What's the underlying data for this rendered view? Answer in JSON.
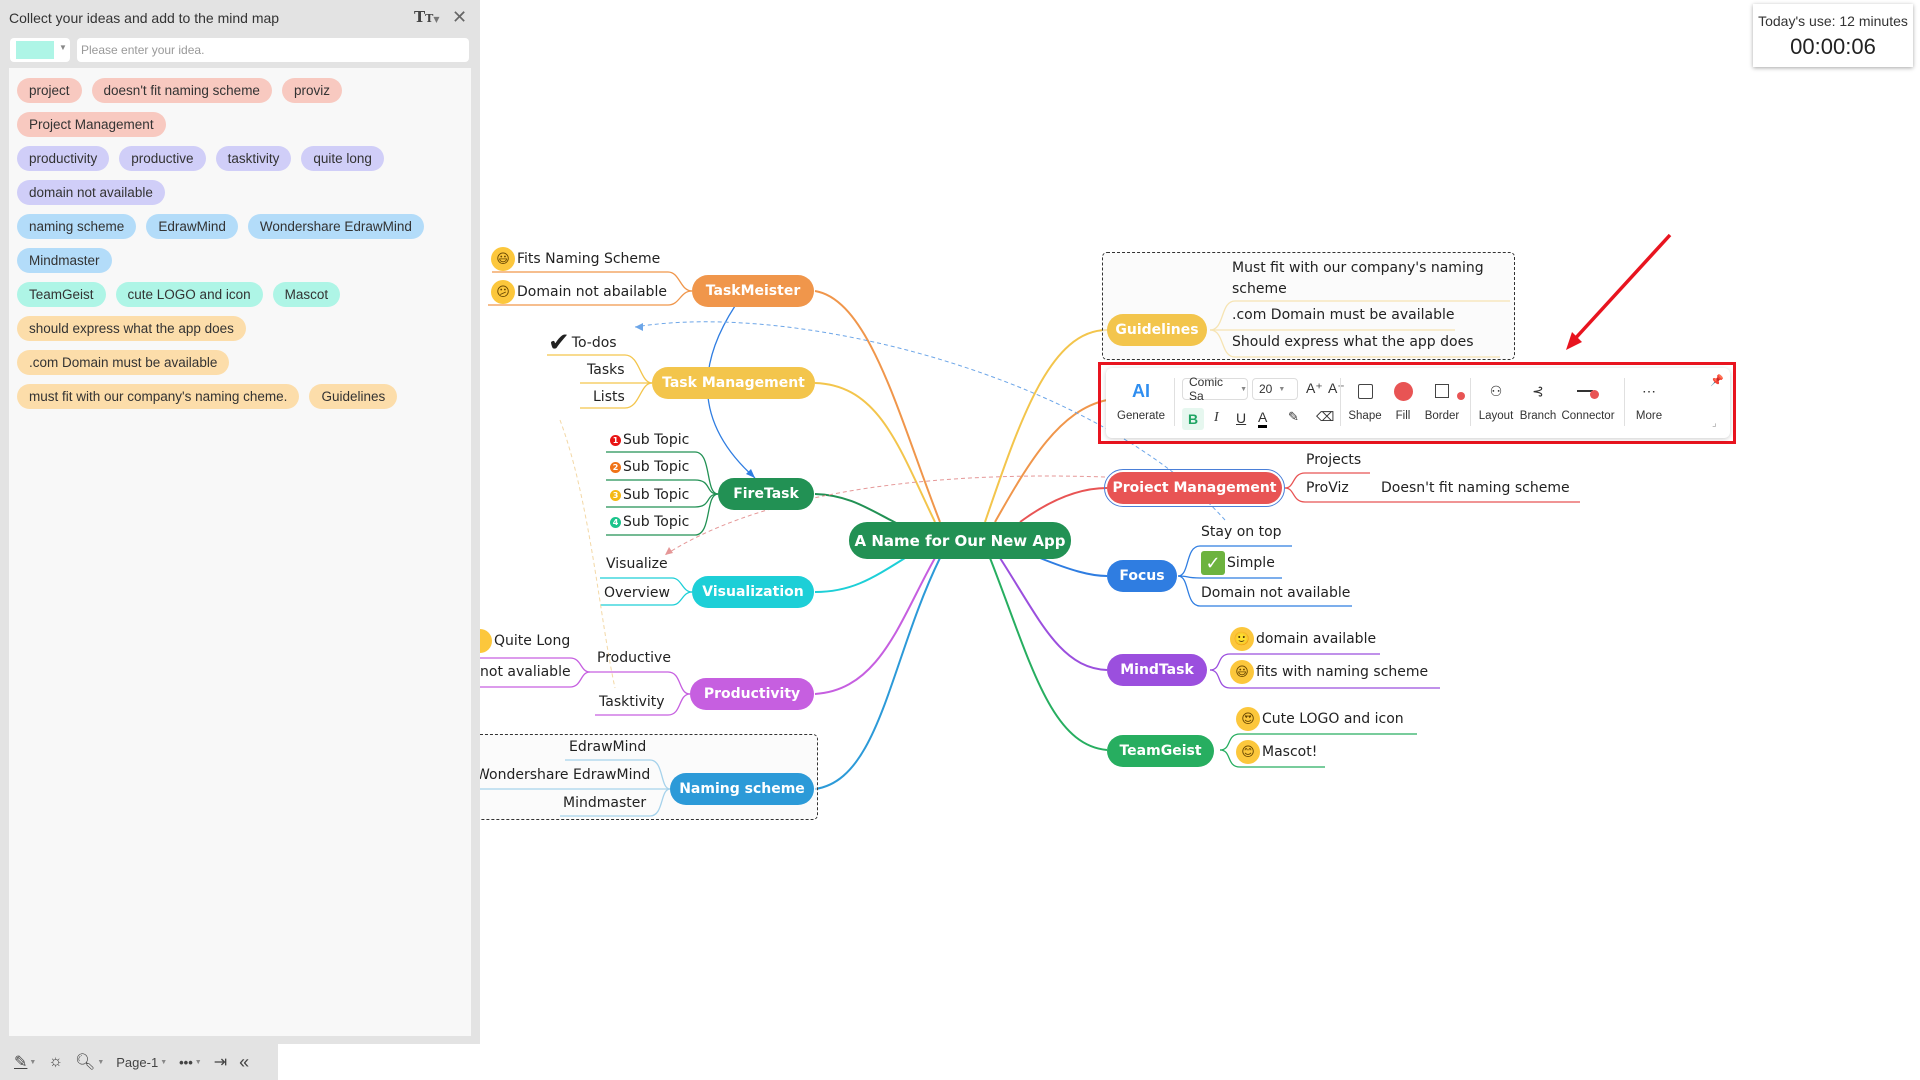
{
  "left_panel": {
    "title": "Collect your ideas and add to the mind map",
    "font_tool_icon": "text-size-icon",
    "close_icon": "close-icon",
    "color_swatch": "#aef5e6",
    "input_placeholder": "Please enter your idea.",
    "tag_rows": [
      [
        {
          "label": "project",
          "color": "#f8c9c0"
        },
        {
          "label": "doesn't fit naming scheme",
          "color": "#f8c9c0"
        },
        {
          "label": "proviz",
          "color": "#f8c9c0"
        }
      ],
      [
        {
          "label": "Project Management",
          "color": "#f8c9c0"
        }
      ],
      [
        {
          "label": "productivity",
          "color": "#d0cef8"
        },
        {
          "label": "productive",
          "color": "#d0cef8"
        },
        {
          "label": "tasktivity",
          "color": "#d0cef8"
        },
        {
          "label": "quite long",
          "color": "#d0cef8"
        }
      ],
      [
        {
          "label": "domain not available",
          "color": "#d0cef8"
        }
      ],
      [
        {
          "label": "naming scheme",
          "color": "#b3dcf9"
        },
        {
          "label": "EdrawMind",
          "color": "#b3dcf9"
        },
        {
          "label": "Wondershare EdrawMind",
          "color": "#b3dcf9"
        }
      ],
      [
        {
          "label": "Mindmaster",
          "color": "#b3dcf9"
        }
      ],
      [
        {
          "label": "TeamGeist",
          "color": "#aef5e6"
        },
        {
          "label": "cute LOGO and icon",
          "color": "#aef5e6"
        },
        {
          "label": "Mascot",
          "color": "#aef5e6"
        }
      ],
      [
        {
          "label": "should express what the app does",
          "color": "#fcddaa"
        }
      ],
      [
        {
          "label": ".com Domain must be available",
          "color": "#fcddaa"
        }
      ],
      [
        {
          "label": "must fit with our company's naming cheme.",
          "color": "#fcddaa"
        },
        {
          "label": "Guidelines",
          "color": "#fcddaa"
        }
      ]
    ]
  },
  "bottom_bar": {
    "pen_icon": "pen-icon",
    "idea_icon": "lightbulb-icon",
    "zoom_icon": "magnifier-icon",
    "page_label": "Page-1",
    "more_icon": "more-dots-icon",
    "exit_icon": "exit-icon",
    "collapse_icon": "double-chevron-left-icon"
  },
  "timer": {
    "label": "Today's use:  12 minutes",
    "value": "00:00:06"
  },
  "toolbar": {
    "ai_label": "AI",
    "generate_label": "Generate",
    "font_name": "Comic Sa",
    "font_size": "20",
    "grow_font": "A⁺",
    "shrink_font": "A⁻",
    "bold": "B",
    "italic": "I",
    "underline": "U",
    "font_color": "A",
    "shape_label": "Shape",
    "fill_label": "Fill",
    "border_label": "Border",
    "layout_label": "Layout",
    "branch_label": "Branch",
    "connector_label": "Connector",
    "more_label": "More",
    "fill_color": "#e85454",
    "highlight_color": "#e8141f"
  },
  "mindmap": {
    "central": {
      "label": "A Name for Our New App",
      "color": "#229154"
    },
    "left_branches": [
      {
        "label": "TaskMeister",
        "color": "#f0964b",
        "children": [
          "Fits Naming Scheme",
          "Domain not abailable"
        ],
        "child_icons": [
          "grinning-face-icon",
          "confused-face-icon"
        ]
      },
      {
        "label": "Task Management",
        "color": "#f3c54c",
        "children": [
          "To-dos",
          "Tasks",
          "Lists"
        ],
        "child_icons": [
          "checkmark-icon",
          "",
          ""
        ]
      },
      {
        "label": "FireTask",
        "color": "#229154",
        "children": [
          "Sub Topic",
          "Sub Topic",
          "Sub Topic",
          "Sub Topic"
        ],
        "child_icons": [
          "priority-1-icon",
          "priority-2-icon",
          "priority-3-icon",
          "priority-4-icon"
        ]
      },
      {
        "label": "Visualization",
        "color": "#1dcfd7",
        "children": [
          "Visualize",
          "Overview"
        ]
      },
      {
        "label": "Productivity",
        "color": "#c65fe0",
        "children": [
          "Productive",
          "Tasktivity"
        ],
        "grandchildren": [
          "Quite Long",
          "not avaliable"
        ]
      },
      {
        "label": "Naming scheme",
        "color": "#2c9ad8",
        "children": [
          "EdrawMind",
          "Wondershare EdrawMind",
          "Mindmaster"
        ]
      }
    ],
    "right_branches": [
      {
        "label": "Guidelines",
        "color": "#f3c54c",
        "children": [
          "Must fit with our company's naming scheme",
          ".com Domain must be available",
          "Should express what the app does"
        ]
      },
      {
        "label": "Proiect Management",
        "color": "#e85454",
        "children": [
          "Projects",
          "ProViz"
        ],
        "grandchild": "Doesn't fit naming scheme"
      },
      {
        "label": "Focus",
        "color": "#2f7de1",
        "children": [
          "Stay on top",
          "Simple",
          "Domain not available"
        ],
        "child_icons": [
          "",
          "check-box-icon",
          ""
        ]
      },
      {
        "label": "MindTask",
        "color": "#9b4fde",
        "children": [
          "domain available",
          "fits with naming scheme"
        ],
        "child_icons": [
          "slightly-smiling-face-icon",
          "grinning-face-icon"
        ]
      },
      {
        "label": "TeamGeist",
        "color": "#27ae60",
        "children": [
          "Cute LOGO and icon",
          "Mascot!"
        ],
        "child_icons": [
          "heart-eyes-face-icon",
          "smiling-blush-face-icon"
        ]
      }
    ]
  }
}
